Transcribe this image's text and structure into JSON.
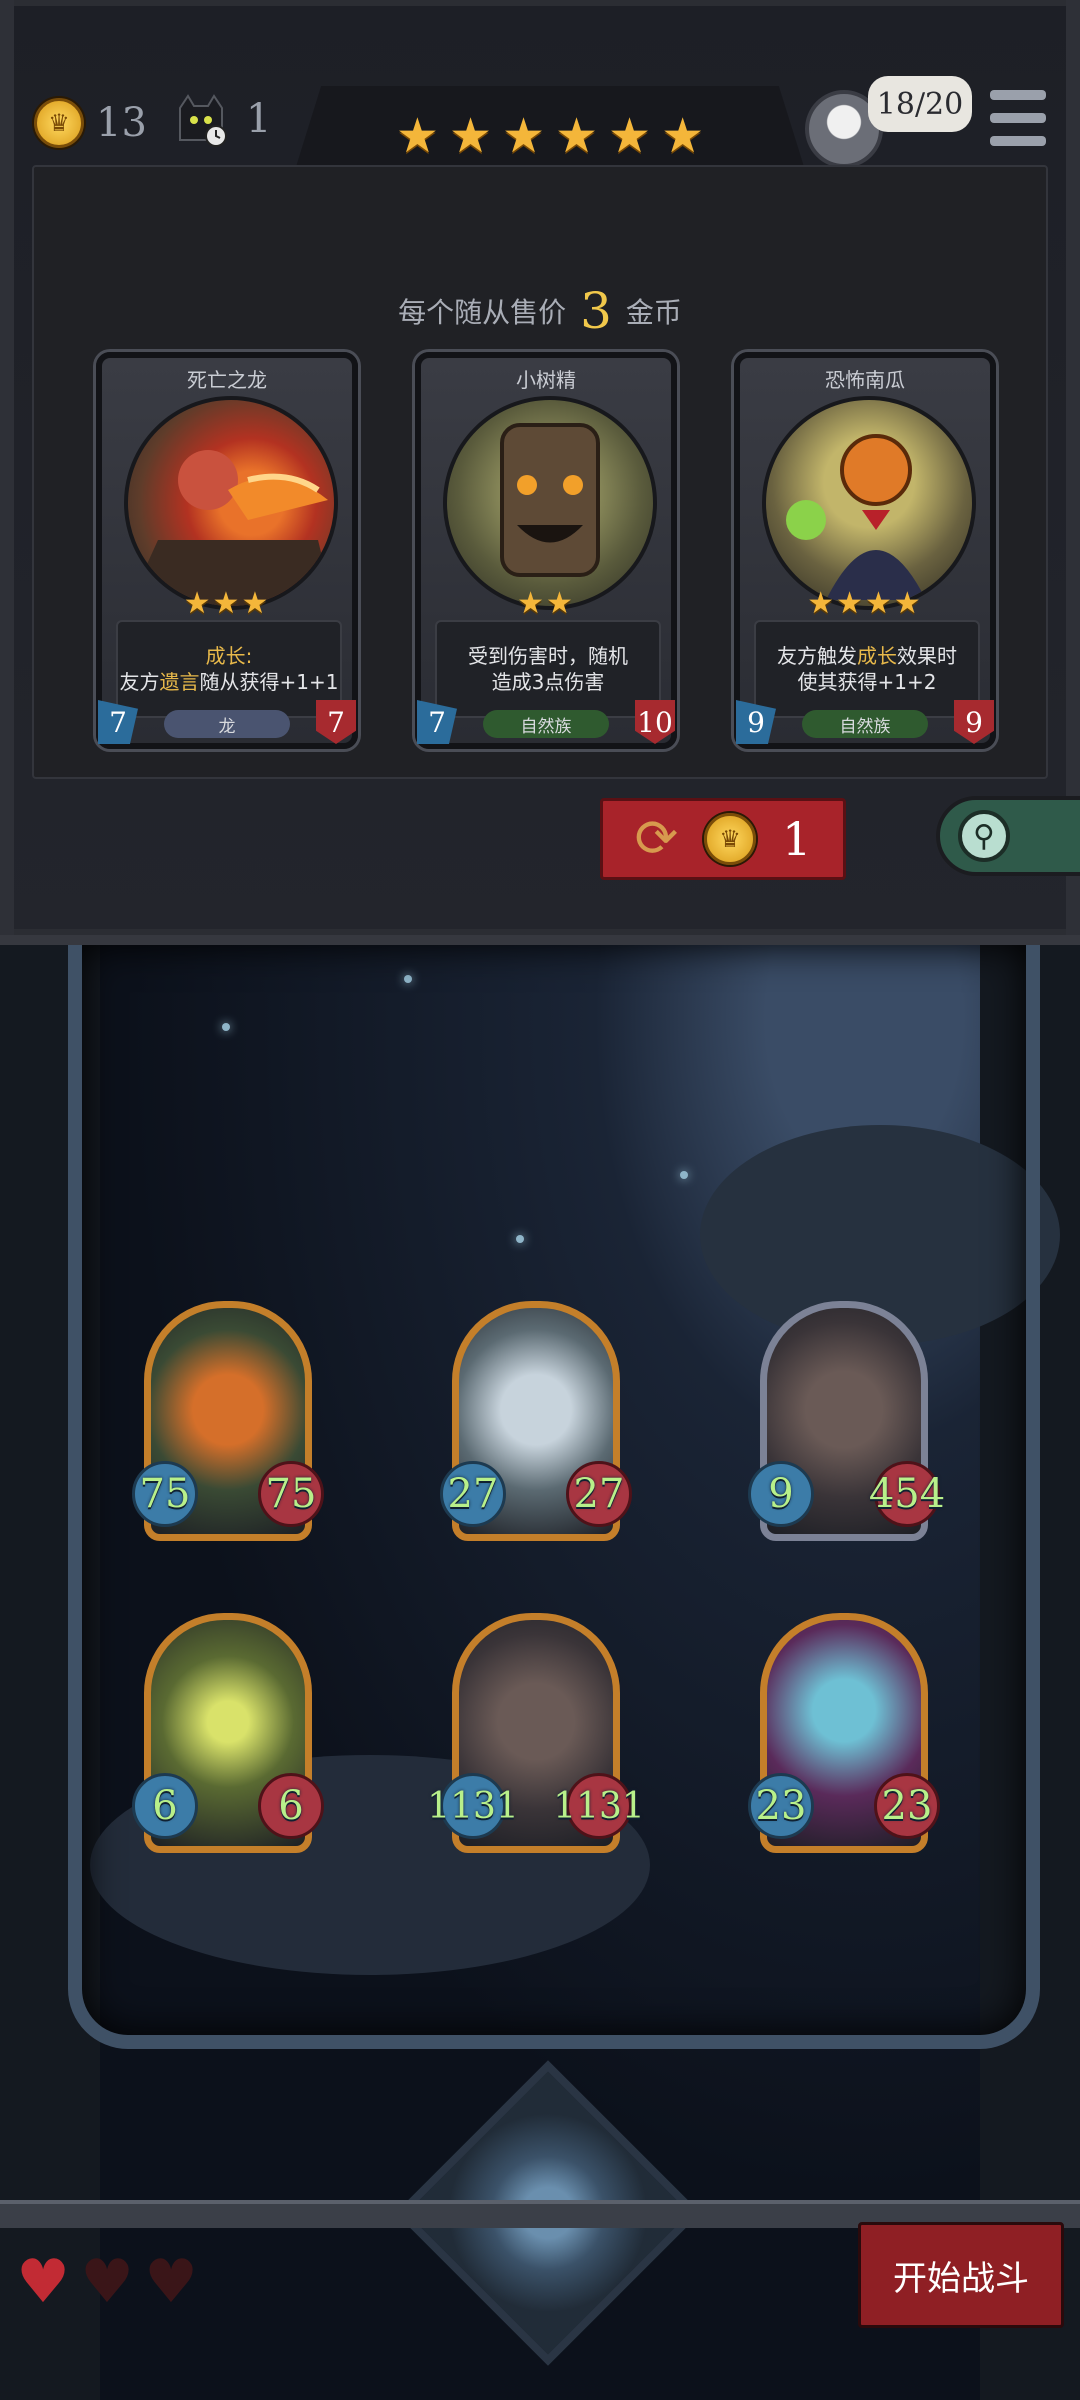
{
  "resources": {
    "gold": "13",
    "cat_count": "1"
  },
  "stars": [
    "★",
    "★",
    "★",
    "★",
    "★",
    "★"
  ],
  "player": {
    "ally_count": "18/20"
  },
  "shop": {
    "sell_prefix": "每个随从售价",
    "sell_value": "3",
    "sell_suffix": "金币",
    "cards": [
      {
        "name": "死亡之龙",
        "stars": "★★★",
        "desc_a": "成长:",
        "desc_b": "友方",
        "desc_hl": "遗言",
        "desc_c": "随从获得+1+1",
        "attack": "7",
        "health": "7",
        "tribe": "龙",
        "tribe_color": "#4a5470"
      },
      {
        "name": "小树精",
        "stars": "★★",
        "desc_a": "受到伤害时，随机",
        "desc_b": "造成3点伤害",
        "attack": "7",
        "health": "10",
        "tribe": "自然族",
        "tribe_color": "#2f5a2f"
      },
      {
        "name": "恐怖南瓜",
        "stars": "★★★★",
        "desc_a": "友方触发",
        "desc_hl": "成长",
        "desc_b": "效果时",
        "desc_c": "使其获得+1+2",
        "attack": "9",
        "health": "9",
        "tribe": "自然族",
        "tribe_color": "#2f5a2f"
      }
    ],
    "refresh_cost": "1"
  },
  "board": [
    {
      "atk": "75",
      "hp": "75",
      "icon": "pumpkin-monster-icon"
    },
    {
      "atk": "27",
      "hp": "27",
      "icon": "bearded-beast-icon"
    },
    {
      "atk": "9",
      "hp": "454",
      "icon": "ogre-chef-icon"
    },
    {
      "atk": "6",
      "hp": "6",
      "icon": "moss-goblin-icon"
    },
    {
      "atk": "1131",
      "hp": "1131",
      "icon": "ogre-chef-icon"
    },
    {
      "atk": "23",
      "hp": "23",
      "icon": "elf-queen-icon"
    }
  ],
  "lives": [
    {
      "state": "full",
      "color": "#c22b34"
    },
    {
      "state": "empty",
      "color": "#3a1518"
    },
    {
      "state": "empty",
      "color": "#3a1518"
    }
  ],
  "start_button": "开始战斗"
}
